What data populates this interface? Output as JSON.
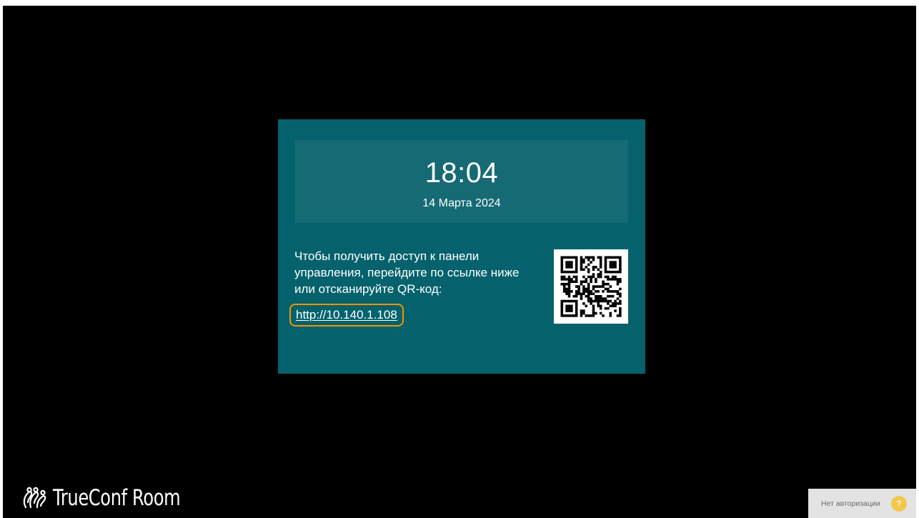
{
  "clock": {
    "time": "18:04",
    "date": "14 Марта 2024"
  },
  "access": {
    "instructions": "Чтобы получить доступ к панели управления, перейдите по ссылке ниже или отсканируйте QR-код:",
    "link": "http://10.140.1.108",
    "qr_icon": "qr-code"
  },
  "branding": {
    "logo_icon": "trueconf-logo",
    "name": "TrueConf Room"
  },
  "auth_status": {
    "label": "Нет авторизации",
    "icon": "?"
  },
  "colors": {
    "background": "#000000",
    "card": "#05626d",
    "clock_panel": "#166a74",
    "link_highlight": "#f39200",
    "auth_icon": "#f2c84b"
  }
}
